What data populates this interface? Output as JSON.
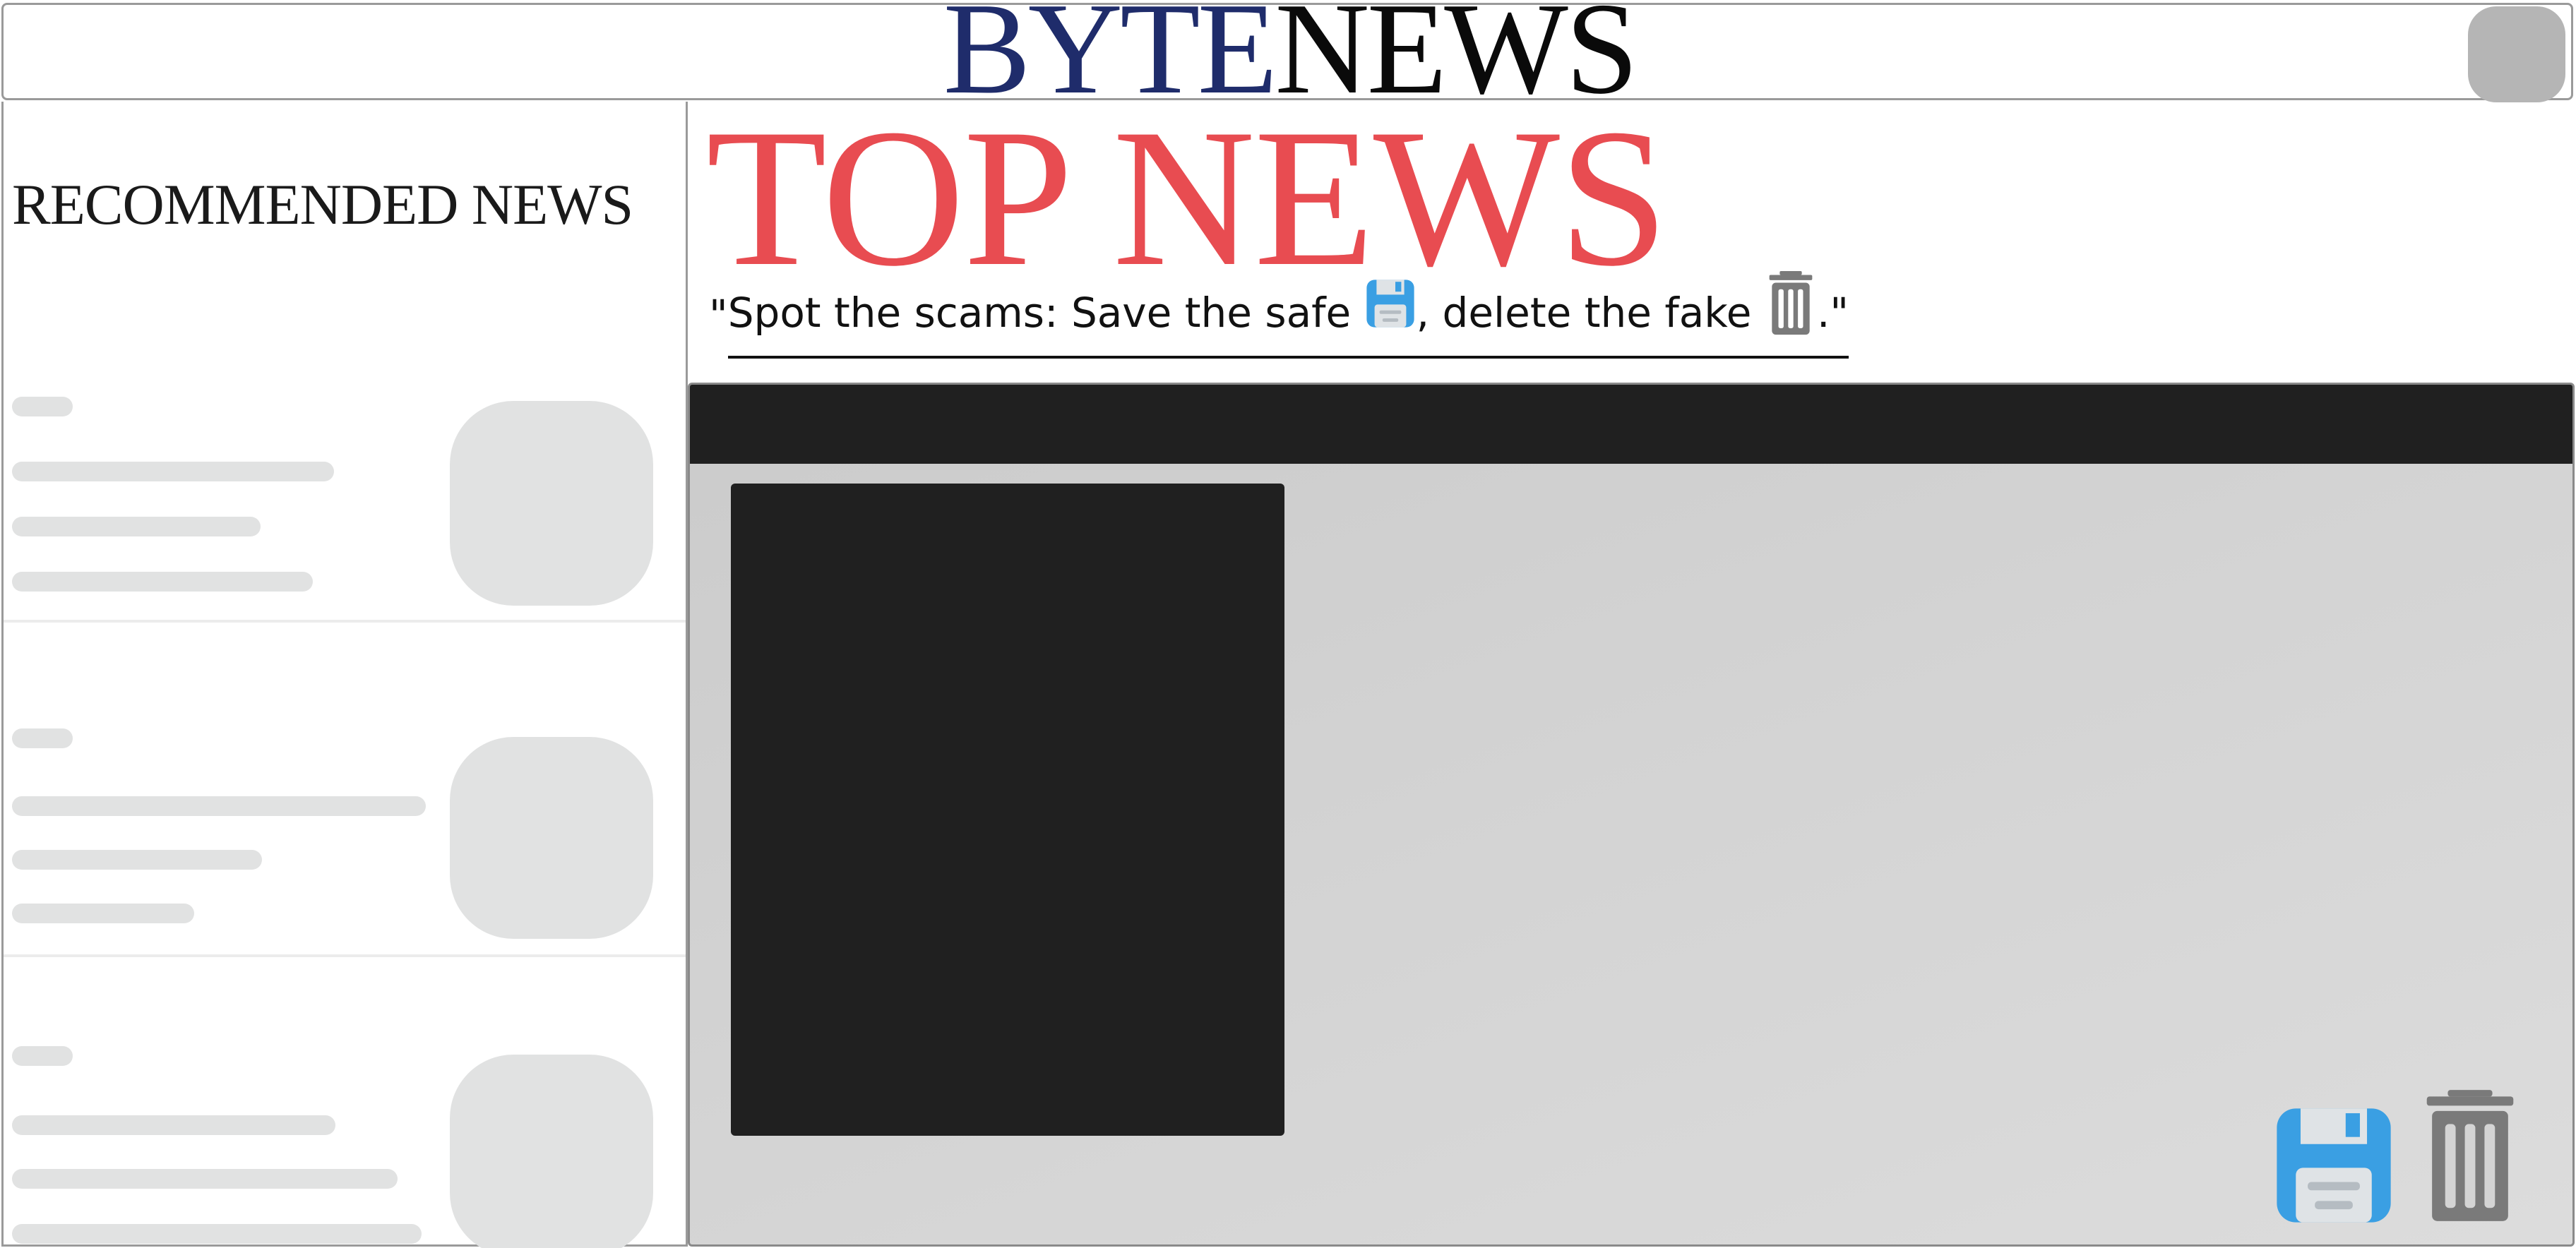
{
  "header": {
    "logo_part1": "BYTE",
    "logo_part2": "NEWS"
  },
  "sidebar": {
    "title": "RECOMMENDED NEWS",
    "cards": [
      {
        "state": "loading-placeholder"
      },
      {
        "state": "loading-placeholder"
      },
      {
        "state": "loading-placeholder"
      }
    ]
  },
  "main": {
    "title": "TOP NEWS",
    "tagline": {
      "open_quote": "\"",
      "part1": "Spot the scams: Save the safe ",
      "part2": ", delete the fake ",
      "close": ".\""
    },
    "article": {
      "actions": [
        {
          "name": "save",
          "icon": "floppy-disk-icon"
        },
        {
          "name": "delete",
          "icon": "trash-icon"
        }
      ]
    }
  },
  "colors": {
    "logo_byte": "#1f2c6b",
    "logo_news": "#0a0a0a",
    "title_accent": "#e84c51",
    "save_icon": "#3a9fe3",
    "trash_icon": "#7a7a7a",
    "dark_block": "#202020",
    "placeholder": "#e1e2e2"
  }
}
